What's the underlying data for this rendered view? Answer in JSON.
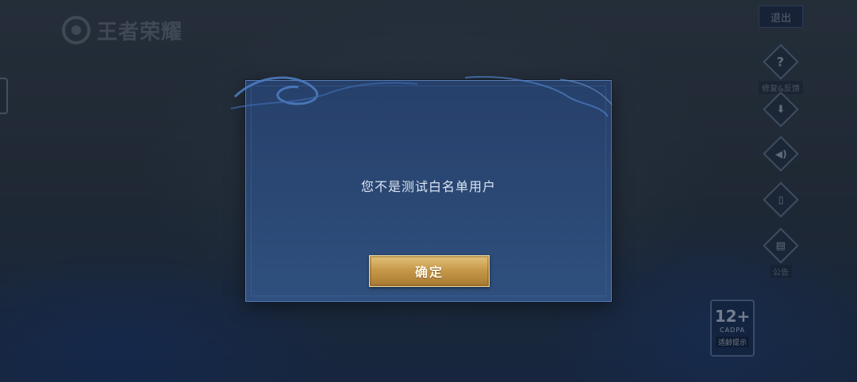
{
  "logo": {
    "text": "王者荣耀"
  },
  "header": {
    "exit_label": "退出"
  },
  "side_buttons": [
    {
      "icon": "question-icon",
      "glyph": "?",
      "label": "修复&反馈"
    },
    {
      "icon": "download-icon",
      "glyph": "⬇",
      "label": ""
    },
    {
      "icon": "volume-icon",
      "glyph": "🔊",
      "label": ""
    },
    {
      "icon": "phone-icon",
      "glyph": "📱",
      "label": ""
    },
    {
      "icon": "notice-icon",
      "glyph": "▤",
      "label": "公告"
    }
  ],
  "age_badge": {
    "rating": "12+",
    "org": "CADPA",
    "tip": "适龄提示"
  },
  "dialog": {
    "message": "您不是测试白名单用户",
    "confirm_label": "确定"
  },
  "colors": {
    "dialog_bg": "#2b4874",
    "button_gold": "#c79a4b",
    "text_light": "#dbe5f3"
  }
}
